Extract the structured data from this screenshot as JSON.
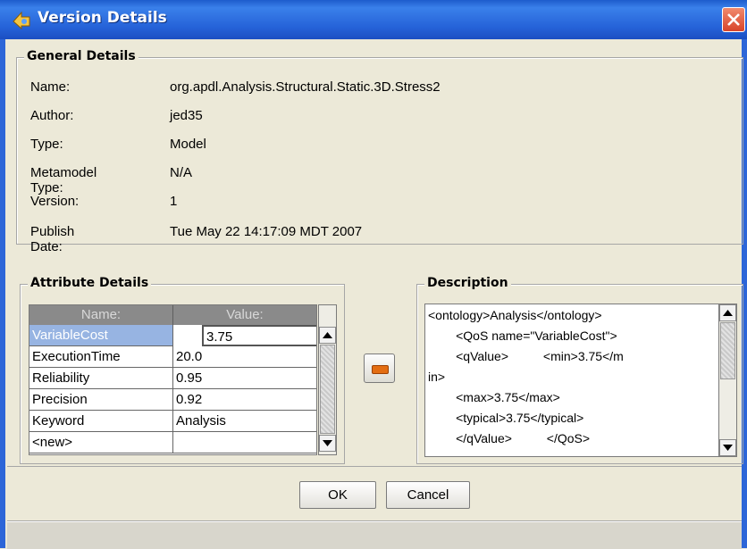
{
  "window": {
    "title": "Version Details"
  },
  "general": {
    "legend": "General Details",
    "rows": [
      {
        "label": "Name:",
        "value": "org.apdl.Analysis.Structural.Static.3D.Stress2"
      },
      {
        "label": "Author:",
        "value": "jed35"
      },
      {
        "label": "Type:",
        "value": "Model"
      },
      {
        "label": "Metamodel Type:",
        "value": "N/A"
      },
      {
        "label": "Version:",
        "value": "1"
      },
      {
        "label": "Publish Date:",
        "value": "Tue May 22 14:17:09 MDT 2007"
      }
    ]
  },
  "attributes": {
    "legend": "Attribute Details",
    "headers": [
      "Name:",
      "Value:"
    ],
    "rows": [
      {
        "name": "VariableCost",
        "value": "3.75"
      },
      {
        "name": "ExecutionTime",
        "value": "20.0"
      },
      {
        "name": "Reliability",
        "value": "0.95"
      },
      {
        "name": "Precision",
        "value": "0.92"
      },
      {
        "name": "Keyword",
        "value": "Analysis"
      },
      {
        "name": "<new>",
        "value": ""
      }
    ]
  },
  "description": {
    "legend": "Description",
    "lines": [
      "<ontology>Analysis</ontology>",
      "        <QoS name=\"VariableCost\">",
      "        <qValue>          <min>3.75</m",
      "in>",
      "        <max>3.75</max>",
      "        <typical>3.75</typical>",
      "        </qValue>          </QoS>"
    ]
  },
  "buttons": {
    "ok": "OK",
    "cancel": "Cancel"
  },
  "icons": {
    "title": "app-icon",
    "close": "close-icon",
    "remove": "minus-icon"
  },
  "colors": {
    "titlebar": "#2562d8",
    "selection": "#97b4e2",
    "remove_button": "#e36d12",
    "close_button": "#d8442a"
  }
}
